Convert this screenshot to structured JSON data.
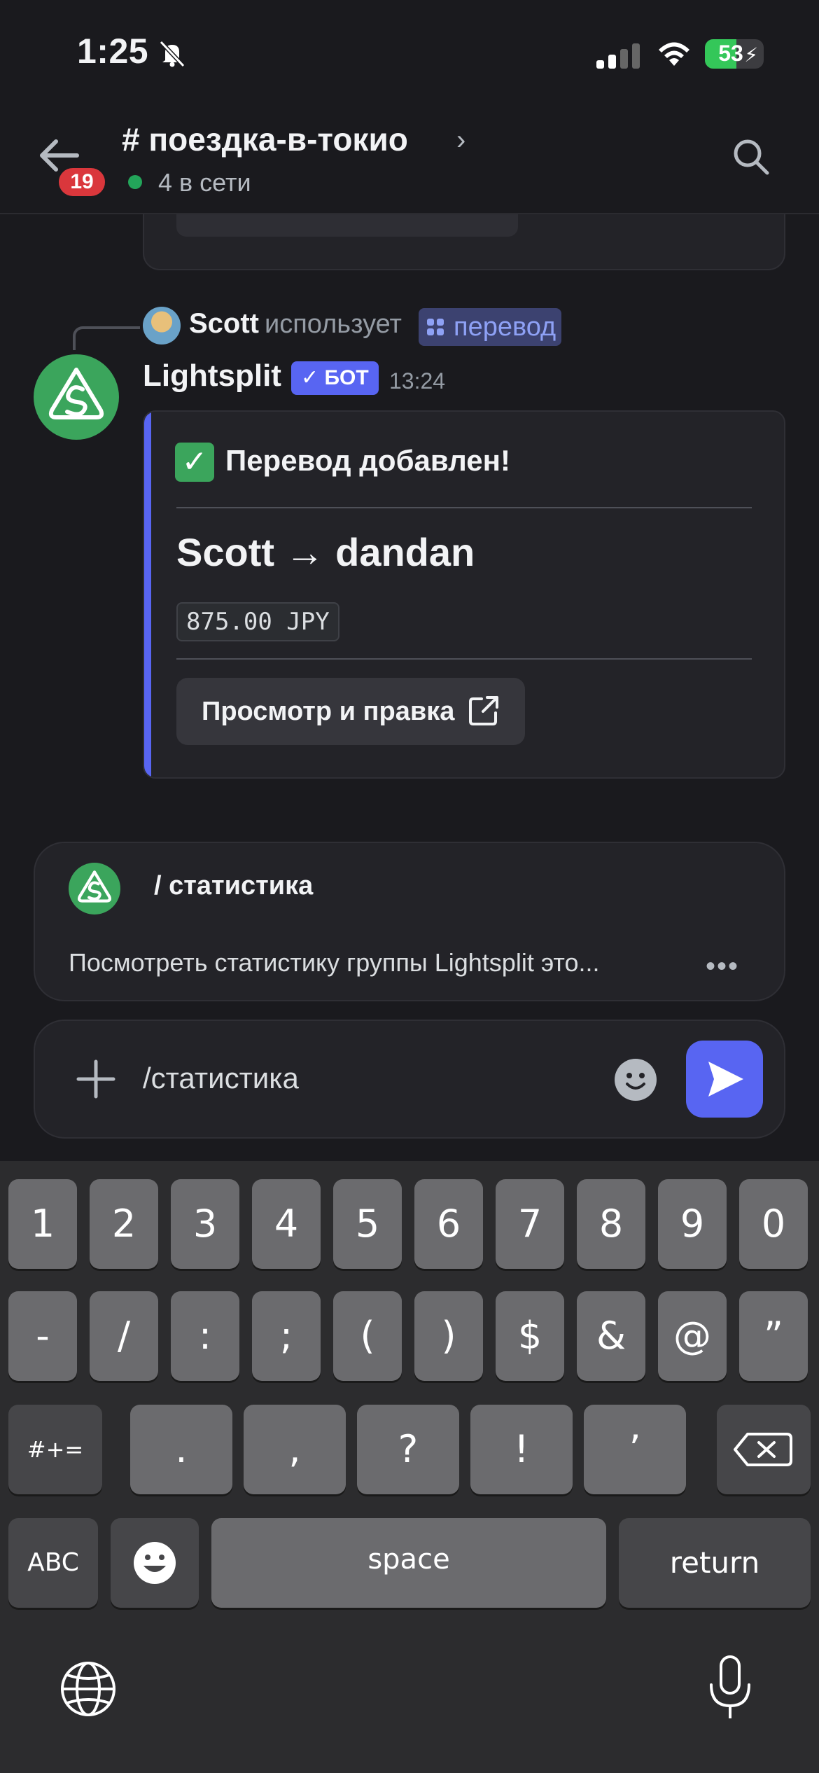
{
  "status": {
    "time": "1:25",
    "battery": "53"
  },
  "header": {
    "unread_badge": "19",
    "channel_name": "# поездка-в-токио",
    "online": "4 в сети"
  },
  "reply": {
    "user": "Scott",
    "uses": "использует",
    "command": "перевод"
  },
  "message": {
    "author": "Lightsplit",
    "tag": "БОТ",
    "time": "13:24",
    "embed": {
      "title": "Перевод добавлен!",
      "transfer": "Scott → dandan",
      "amount": "875.00 JPY",
      "button_label": "Просмотр и правка"
    }
  },
  "suggestion": {
    "command": "/ статистика",
    "description": "Посмотреть статистику группы Lightsplit это..."
  },
  "composer": {
    "value": "/статистика"
  },
  "keyboard": {
    "row1": [
      "1",
      "2",
      "3",
      "4",
      "5",
      "6",
      "7",
      "8",
      "9",
      "0"
    ],
    "row2": [
      "-",
      "/",
      ":",
      ";",
      "(",
      ")",
      "$",
      "&",
      "@",
      "”"
    ],
    "row3": [
      ".",
      ",",
      "?",
      "!",
      "’"
    ],
    "mode_symbols": "#+=",
    "mode_abc": "ABC",
    "space": "space",
    "return": "return"
  },
  "colors": {
    "blurple": "#5865f2",
    "green": "#3ba55c",
    "red_badge": "#da373c"
  }
}
